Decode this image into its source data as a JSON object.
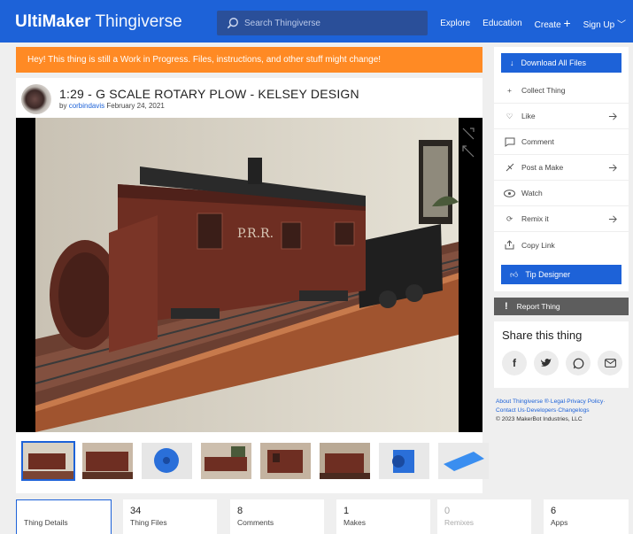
{
  "nav": {
    "logo_bold": "UltiMaker",
    "logo_light": "Thingiverse",
    "search_placeholder": "Search Thingiverse",
    "explore": "Explore",
    "education": "Education",
    "create": "Create",
    "signup": "Sign Up"
  },
  "banner": "Hey! This thing is still a Work in Progress. Files, instructions, and other stuff might change!",
  "thing": {
    "title": "1:29 - G SCALE ROTARY PLOW - KELSEY DESIGN",
    "by": "by",
    "author": "corbindavis",
    "date": "February 24, 2021"
  },
  "actions": {
    "download": "Download All Files",
    "collect": "Collect Thing",
    "like": "Like",
    "comment": "Comment",
    "post_make": "Post a Make",
    "watch": "Watch",
    "remix": "Remix it",
    "copy_link": "Copy Link",
    "tip": "Tip Designer",
    "report": "Report Thing"
  },
  "share": {
    "title": "Share this thing",
    "icons": [
      "facebook-icon",
      "twitter-icon",
      "whatsapp-icon",
      "mail-icon"
    ]
  },
  "footer": {
    "line1": "About Thingiverse ®·Legal·Privacy Policy·",
    "line2": "Contact Us·Developers·Changelogs",
    "copyright": "© 2023 MakerBot Industries, LLC"
  },
  "stats": [
    {
      "num": "",
      "label": "Thing Details"
    },
    {
      "num": "34",
      "label": "Thing Files"
    },
    {
      "num": "8",
      "label": "Comments"
    },
    {
      "num": "1",
      "label": "Makes"
    },
    {
      "num": "0",
      "label": "Remixes"
    },
    {
      "num": "6",
      "label": "Apps"
    }
  ],
  "colors": {
    "brand_blue": "#1d62d8",
    "banner_orange": "#ff8a24",
    "report_gray": "#5d5d5d"
  }
}
